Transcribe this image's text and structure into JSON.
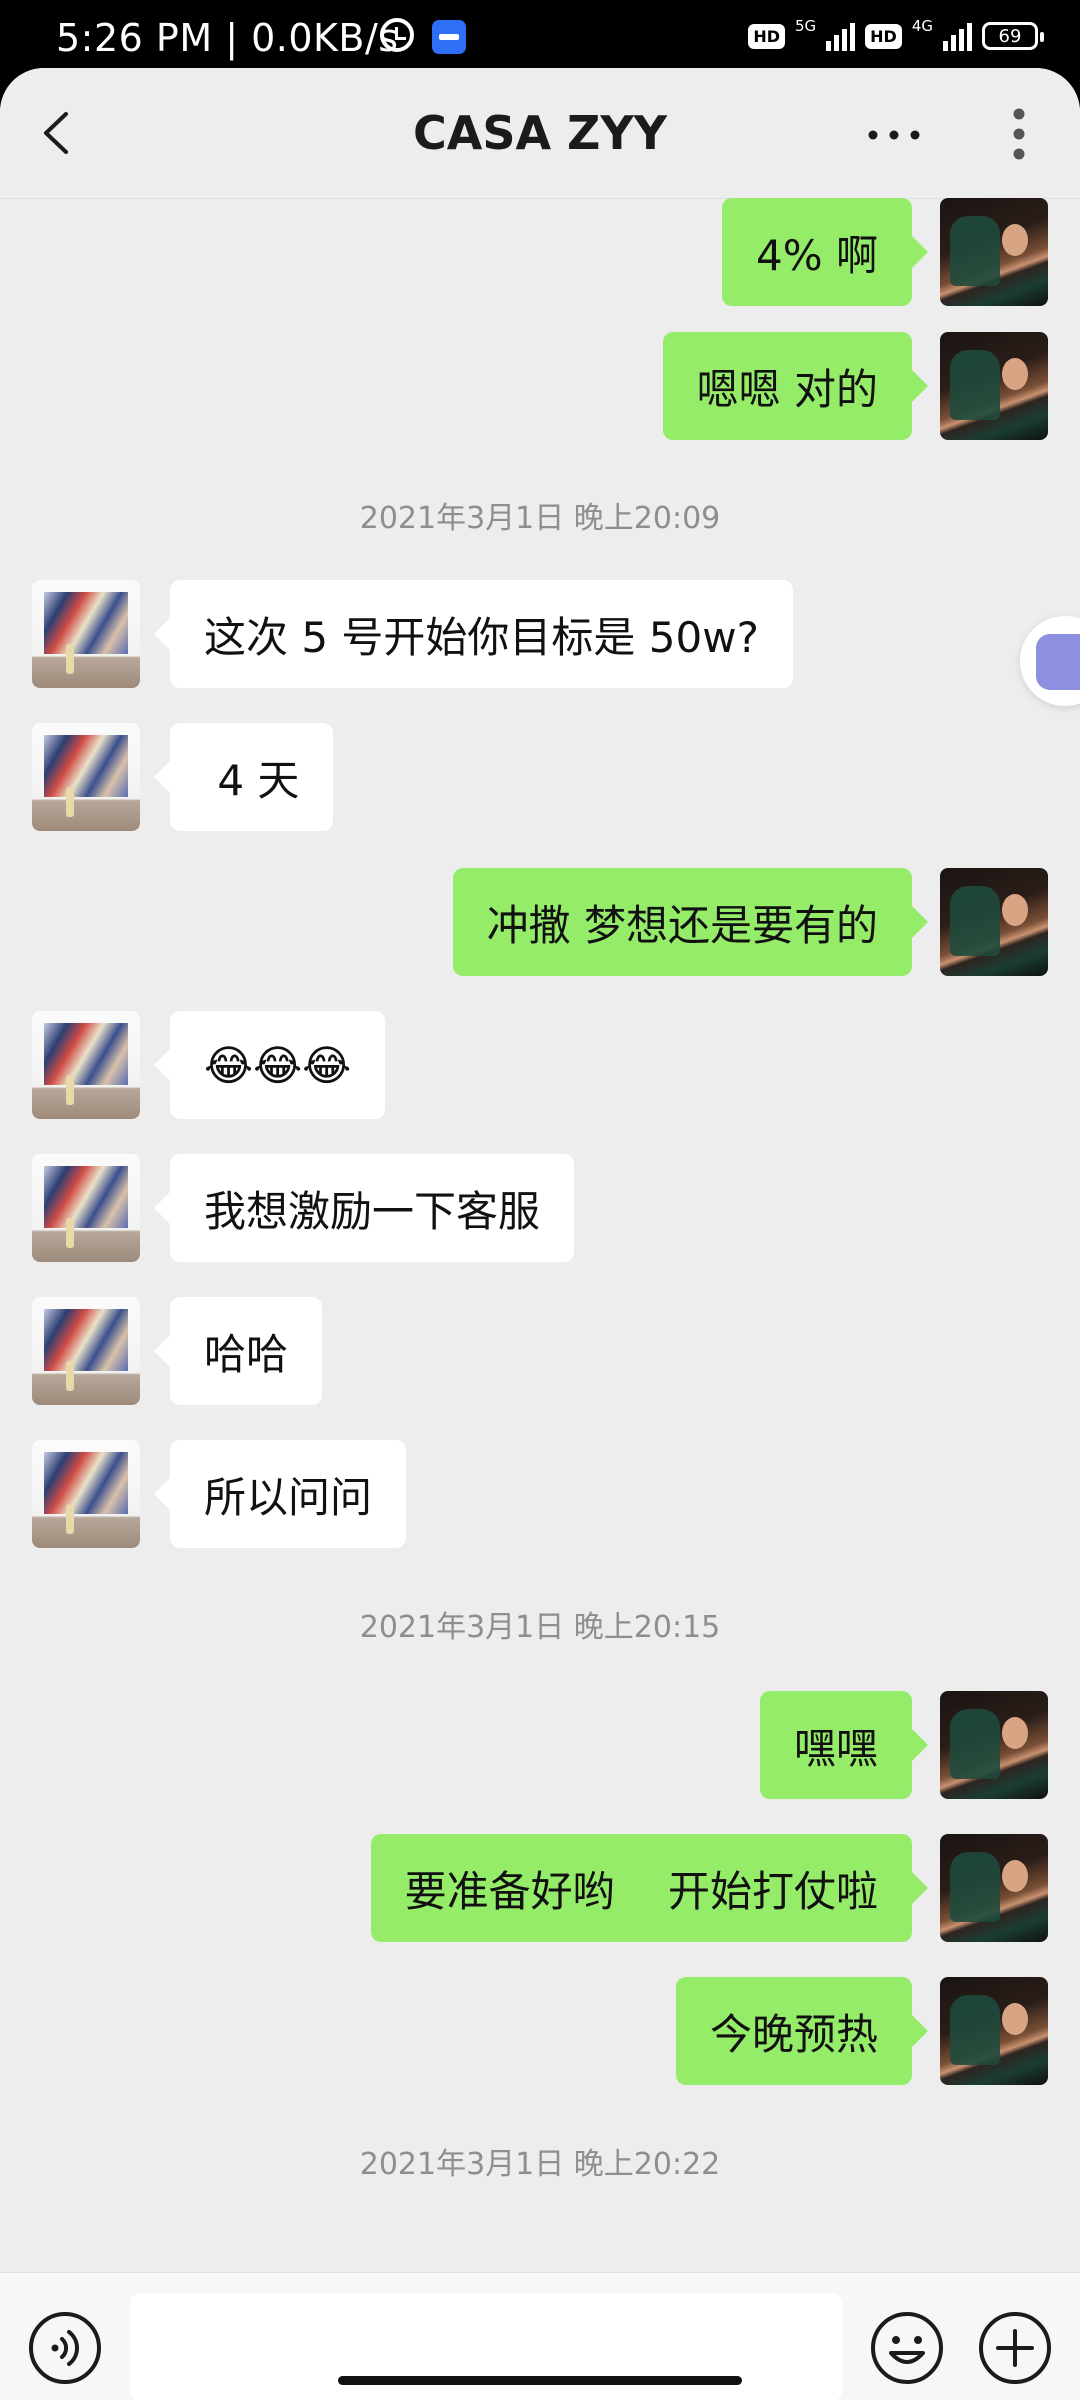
{
  "status_bar": {
    "time_speed": "5:26 PM | 0.0KB/s",
    "hd1": "HD",
    "net1": "5G",
    "hd2": "HD",
    "net2": "4G",
    "battery": "69"
  },
  "header": {
    "title": "CASA ZYY"
  },
  "messages": [
    {
      "sender": "me",
      "text": "4% 啊"
    },
    {
      "sender": "me",
      "text": "嗯嗯 对的"
    },
    {
      "type": "timestamp",
      "text": "2021年3月1日 晚上20:09"
    },
    {
      "sender": "other",
      "text": "这次 5 号开始你目标是 50w?"
    },
    {
      "sender": "other",
      "text": " 4 天"
    },
    {
      "sender": "me",
      "text": "冲撒 梦想还是要有的"
    },
    {
      "sender": "other",
      "text": "😂😂😂"
    },
    {
      "sender": "other",
      "text": "我想激励一下客服"
    },
    {
      "sender": "other",
      "text": "哈哈"
    },
    {
      "sender": "other",
      "text": "所以问问"
    },
    {
      "type": "timestamp",
      "text": "2021年3月1日 晚上20:15"
    },
    {
      "sender": "me",
      "text": "嘿嘿"
    },
    {
      "sender": "me",
      "text": "要准备好哟    开始打仗啦"
    },
    {
      "sender": "me",
      "text": "今晚预热"
    },
    {
      "type": "timestamp",
      "text": "2021年3月1日 晚上20:22"
    }
  ],
  "input": {
    "value": ""
  },
  "colors": {
    "my_bubble": "#95ec69",
    "their_bubble": "#ffffff",
    "chat_background": "#ededed"
  }
}
